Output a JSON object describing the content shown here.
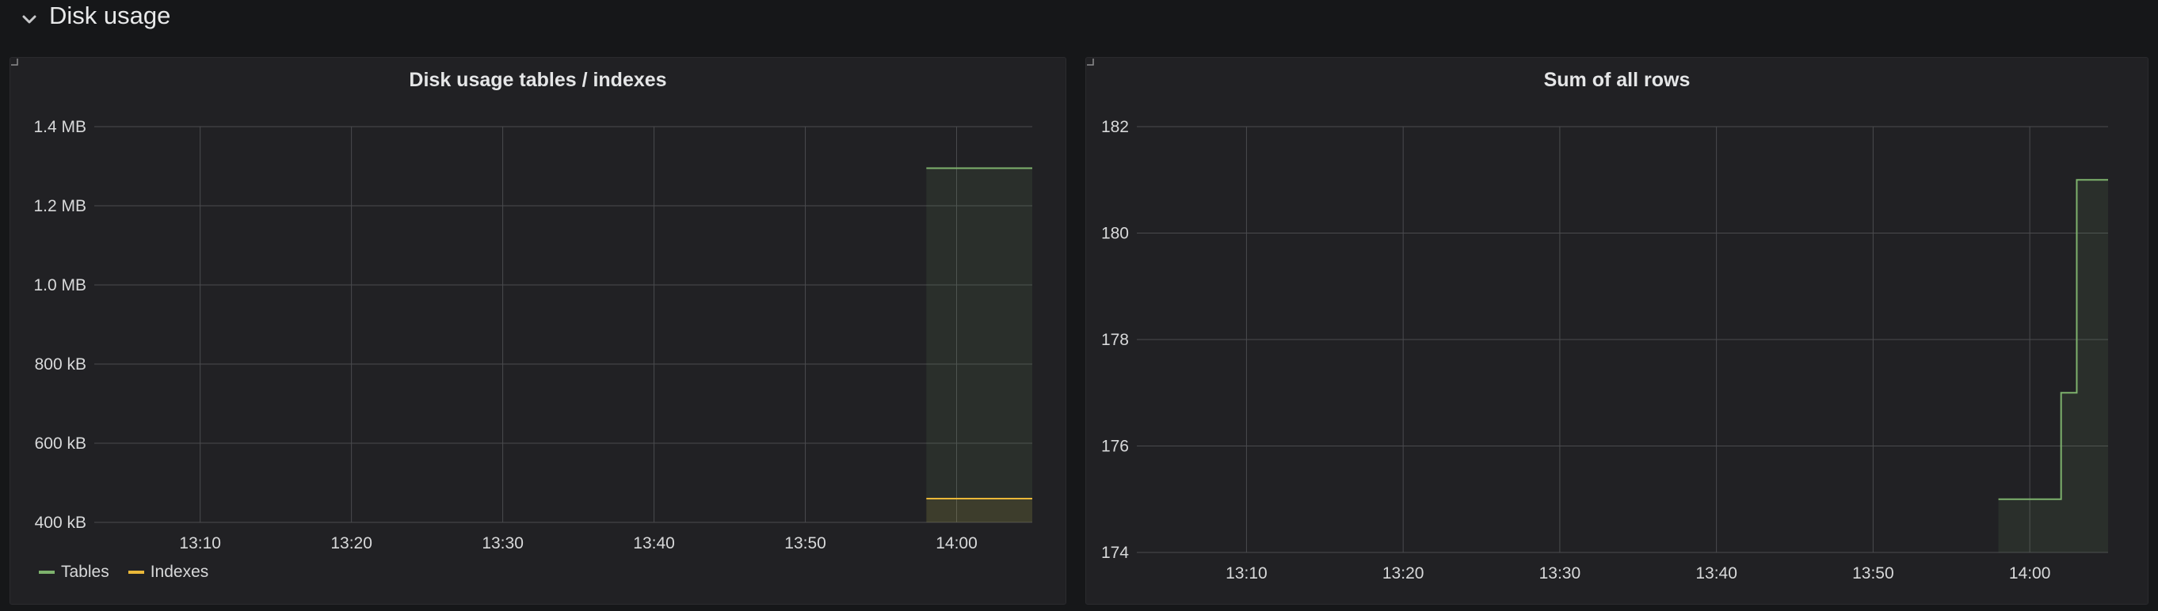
{
  "row": {
    "title": "Disk usage",
    "chevron_icon": "chevron-down-icon"
  },
  "colors": {
    "tables": "#7eb26d",
    "indexes": "#eab839",
    "grid": "#4a4b4e",
    "text": "#d8d9da"
  },
  "panels": [
    {
      "title": "Disk usage tables / indexes",
      "legend": [
        {
          "label": "Tables",
          "color": "#7eb26d"
        },
        {
          "label": "Indexes",
          "color": "#eab839"
        }
      ]
    },
    {
      "title": "Sum of all rows",
      "legend": []
    }
  ],
  "chart_data": [
    {
      "type": "area",
      "title": "Disk usage tables / indexes",
      "xlabel": "",
      "ylabel": "",
      "x_range": [
        "13:03",
        "14:05"
      ],
      "x_ticks": [
        "13:10",
        "13:20",
        "13:30",
        "13:40",
        "13:50",
        "14:00"
      ],
      "y_ticks": [
        "400 kB",
        "600 kB",
        "800 kB",
        "1.0 MB",
        "1.2 MB",
        "1.4 MB"
      ],
      "ylim_kB": [
        400,
        1400
      ],
      "grid": true,
      "legend_position": "bottom-left",
      "series": [
        {
          "name": "Tables",
          "color": "#7eb26d",
          "x": [
            "13:58",
            "14:05"
          ],
          "y_kB": [
            1295,
            1295
          ]
        },
        {
          "name": "Indexes",
          "color": "#eab839",
          "x": [
            "13:58",
            "14:05"
          ],
          "y_kB": [
            460,
            460
          ]
        }
      ]
    },
    {
      "type": "area",
      "title": "Sum of all rows",
      "xlabel": "",
      "ylabel": "",
      "x_range": [
        "13:03",
        "14:05"
      ],
      "x_ticks": [
        "13:10",
        "13:20",
        "13:30",
        "13:40",
        "13:50",
        "14:00"
      ],
      "y_ticks": [
        "174",
        "176",
        "178",
        "180",
        "182"
      ],
      "ylim": [
        174,
        182
      ],
      "grid": true,
      "legend_position": "none",
      "series": [
        {
          "color": "#7eb26d",
          "step": true,
          "x": [
            "13:58",
            "14:01",
            "14:02",
            "14:03",
            "14:05"
          ],
          "y": [
            175,
            175,
            177,
            181,
            181
          ]
        }
      ]
    }
  ]
}
